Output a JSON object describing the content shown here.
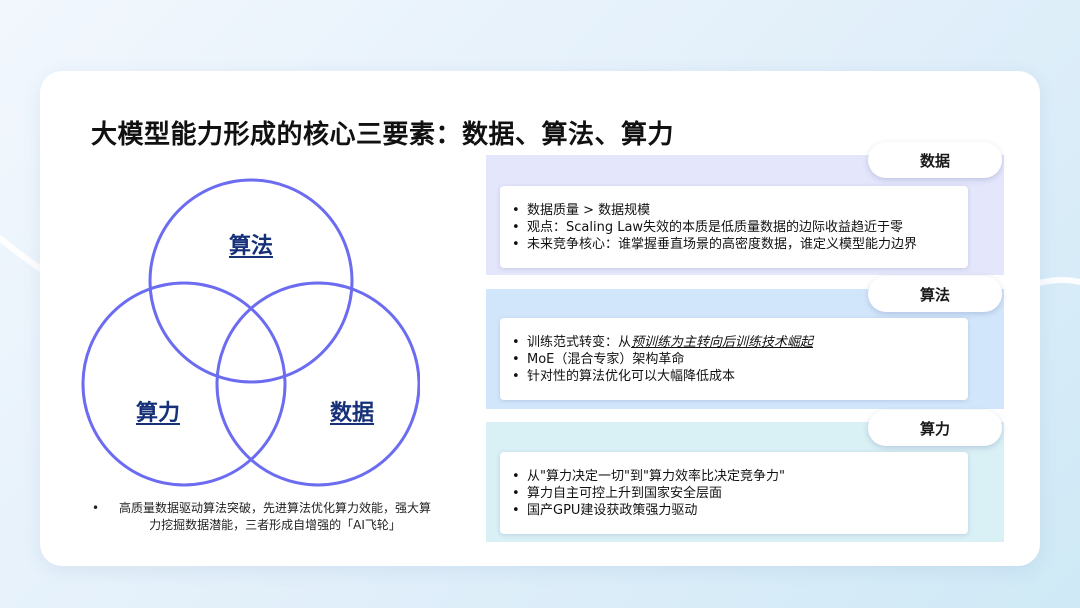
{
  "slide": {
    "title": "大模型能力形成的核心三要素：数据、算法、算力"
  },
  "venn": {
    "circles": [
      {
        "label": "算法"
      },
      {
        "label": "算力"
      },
      {
        "label": "数据"
      }
    ],
    "circle_color": "#6b6cf0",
    "label_color": "#16307a",
    "caption_bullet": "•",
    "caption": "高质量数据驱动算法突破，先进算法优化算力效能，强大算力挖掘数据潜能，三者形成自增强的「AI飞轮」"
  },
  "sections": [
    {
      "title": "数据",
      "panel_color": "#e4e6fb",
      "items": [
        {
          "text": "数据质量 > 数据规模"
        },
        {
          "text": "观点：Scaling Law失效的本质是低质量数据的边际收益趋近于零"
        },
        {
          "text": "未来竞争核心：谁掌握垂直场景的高密度数据，谁定义模型能力边界"
        }
      ]
    },
    {
      "title": "算法",
      "panel_color": "#d2e6fb",
      "items": [
        {
          "prefix": "训练范式转变：从",
          "emphasis": "预训练为主转向后训练技术崛起"
        },
        {
          "text": "MoE（混合专家）架构革命"
        },
        {
          "text": "针对性的算法优化可以大幅降低成本"
        }
      ]
    },
    {
      "title": "算力",
      "panel_color": "#d9f0f5",
      "items": [
        {
          "text": "从\"算力决定一切\"到\"算力效率比决定竞争力\""
        },
        {
          "text": "算力自主可控上升到国家安全层面"
        },
        {
          "text": "国产GPU建设获政策强力驱动"
        }
      ]
    }
  ]
}
